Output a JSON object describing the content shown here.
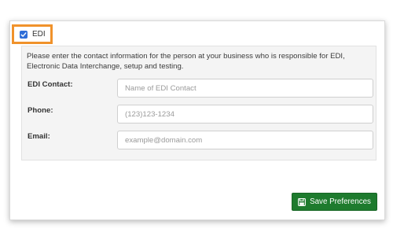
{
  "edi_toggle": {
    "label": "EDI",
    "checked": true
  },
  "panel": {
    "instructions": "Please enter the contact information for the person at your business who is responsible for EDI, Electronic Data Interchange, setup and testing.",
    "fields": [
      {
        "label": "EDI Contact:",
        "placeholder": "Name of EDI Contact",
        "value": ""
      },
      {
        "label": "Phone:",
        "placeholder": "(123)123-1234",
        "value": ""
      },
      {
        "label": "Email:",
        "placeholder": "example@domain.com",
        "value": ""
      }
    ]
  },
  "save_button": {
    "label": "Save Preferences",
    "icon": "save-icon"
  },
  "colors": {
    "highlight_border": "#f0922b",
    "checkbox": "#2f6ed8",
    "save_button": "#1e7b2e",
    "panel_background": "#f4f4f4"
  }
}
